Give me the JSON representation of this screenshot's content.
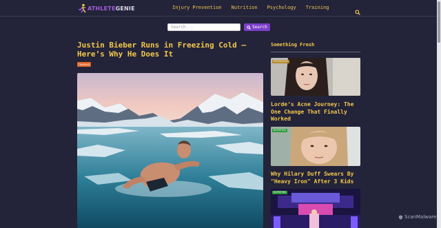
{
  "header": {
    "logo": {
      "athlete": "ATHLETE",
      "genie": "GENIE"
    },
    "nav": [
      "Injury Prevention",
      "Nutrition",
      "Psychology",
      "Training"
    ]
  },
  "search": {
    "placeholder": "Search...",
    "button_label": "Search"
  },
  "article": {
    "title": "Justin Bieber Runs in Freezing Cold — Here’s Why He Does It",
    "tag": "Training"
  },
  "sidebar": {
    "heading": "Something Fresh",
    "cards": [
      {
        "tag": "Psychology",
        "title": "Lorde’s Acne Journey: The One Change That Finally Worked",
        "tag_color": "#b58a2a"
      },
      {
        "tag": "Nutrition",
        "title": "Why Hilary Duff Swears By \"Heavy Iron\" After 3 Kids",
        "tag_color": "#2f9a3c"
      },
      {
        "tag": "Nutrition",
        "title": "",
        "tag_color": "#2f9a3c"
      }
    ]
  },
  "watermark": "ScanMalware"
}
